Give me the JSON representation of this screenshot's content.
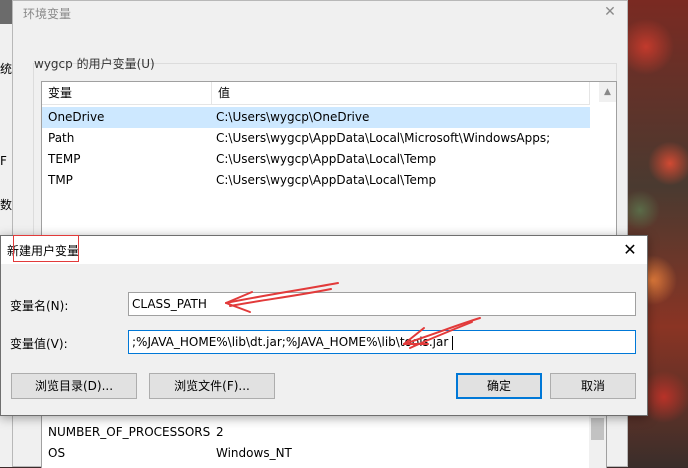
{
  "env_dialog": {
    "title": "环境变量",
    "close_glyph": "✕",
    "user_vars_group_label": "wygcp 的用户变量(U)",
    "columns": [
      "变量",
      "值"
    ],
    "rows": [
      {
        "name": "OneDrive",
        "value": "C:\\Users\\wygcp\\OneDrive",
        "selected": true
      },
      {
        "name": "Path",
        "value": "C:\\Users\\wygcp\\AppData\\Local\\Microsoft\\WindowsApps;",
        "selected": false
      },
      {
        "name": "TEMP",
        "value": "C:\\Users\\wygcp\\AppData\\Local\\Temp",
        "selected": false
      },
      {
        "name": "TMP",
        "value": "C:\\Users\\wygcp\\AppData\\Local\\Temp",
        "selected": false
      }
    ],
    "system_rows": [
      {
        "name": "NUMBER_OF_PROCESSORS",
        "value": "2"
      },
      {
        "name": "OS",
        "value": "Windows_NT"
      }
    ]
  },
  "background_fragments": {
    "frag1": "统称",
    "frag2": "F",
    "frag3": "数更"
  },
  "new_var_dialog": {
    "title": "新建用户变量",
    "close_glyph": "✕",
    "name_label": "变量名(N):",
    "name_value": "CLASS_PATH",
    "value_label": "变量值(V):",
    "value_value": ";%JAVA_HOME%\\lib\\dt.jar;%JAVA_HOME%\\lib\\tools.jar",
    "browse_dir_label": "浏览目录(D)...",
    "browse_file_label": "浏览文件(F)...",
    "ok_label": "确定",
    "cancel_label": "取消"
  },
  "colors": {
    "accent": "#0078d7",
    "annotation_red": "#e23a3a",
    "selected_row": "#cde8ff"
  },
  "icons": {
    "close": "close-icon",
    "scroll_up": "scroll-up-arrow-icon"
  }
}
